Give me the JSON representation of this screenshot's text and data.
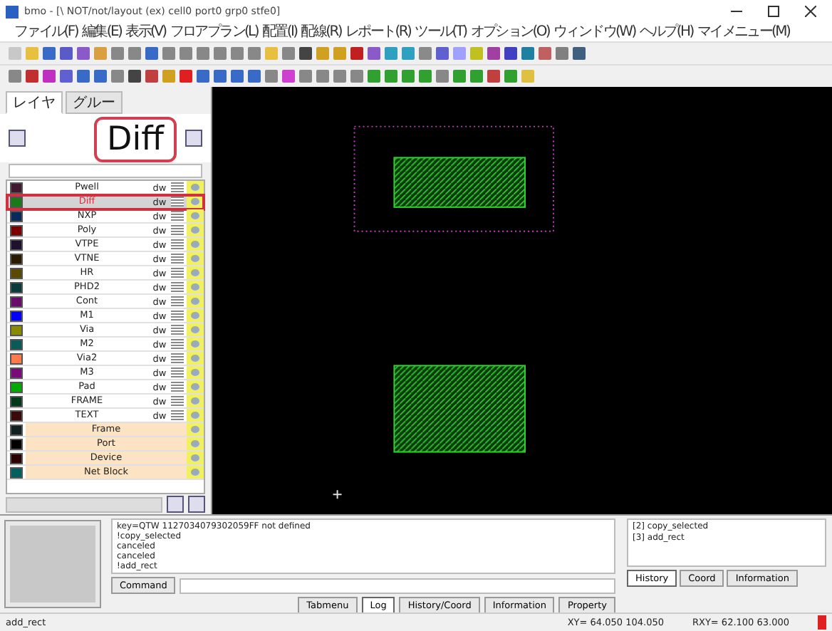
{
  "window": {
    "title": "bmo - [\\ NOT/not/layout (ex) cell0 port0 grp0 stfe0]"
  },
  "menu": [
    "ファイル(F)",
    "編集(E)",
    "表示(V)",
    "フロアプラン(L)",
    "配置(I)",
    "配線(R)",
    "レポート(R)",
    "ツール(T)",
    "オプション(O)",
    "ウィンドウ(W)",
    "ヘルプ(H)",
    "マイメニュー(M)"
  ],
  "layer_panel": {
    "tabs": [
      {
        "label": "レイヤ",
        "selected": true
      },
      {
        "label": "グルー",
        "selected": false
      }
    ],
    "callout": "Diff",
    "layers": [
      {
        "kind": "layer",
        "name": "Pwell",
        "mode": "dw",
        "color": "#401830",
        "selected": false
      },
      {
        "kind": "layer",
        "name": "Diff",
        "mode": "dw",
        "color": "#1a7a1a",
        "selected": true
      },
      {
        "kind": "layer",
        "name": "NXP",
        "mode": "dw",
        "color": "#0a2a5a",
        "selected": false
      },
      {
        "kind": "layer",
        "name": "Poly",
        "mode": "dw",
        "color": "#7a0000",
        "selected": false
      },
      {
        "kind": "layer",
        "name": "VTPE",
        "mode": "dw",
        "color": "#201030",
        "selected": false
      },
      {
        "kind": "layer",
        "name": "VTNE",
        "mode": "dw",
        "color": "#2a1a00",
        "selected": false
      },
      {
        "kind": "layer",
        "name": "HR",
        "mode": "dw",
        "color": "#5a4a00",
        "selected": false
      },
      {
        "kind": "layer",
        "name": "PHD2",
        "mode": "dw",
        "color": "#0a3a3a",
        "selected": false
      },
      {
        "kind": "layer",
        "name": "Cont",
        "mode": "dw",
        "color": "#6a0a6a",
        "selected": false
      },
      {
        "kind": "layer",
        "name": "M1",
        "mode": "dw",
        "color": "#0000ff",
        "selected": false
      },
      {
        "kind": "layer",
        "name": "Via",
        "mode": "dw",
        "color": "#8a8a00",
        "selected": false
      },
      {
        "kind": "layer",
        "name": "M2",
        "mode": "dw",
        "color": "#0a5a5a",
        "selected": false
      },
      {
        "kind": "layer",
        "name": "Via2",
        "mode": "dw",
        "color": "#ff7a4a",
        "selected": false
      },
      {
        "kind": "layer",
        "name": "M3",
        "mode": "dw",
        "color": "#7a0a7a",
        "selected": false
      },
      {
        "kind": "layer",
        "name": "Pad",
        "mode": "dw",
        "color": "#00aa00",
        "selected": false
      },
      {
        "kind": "layer",
        "name": "FRAME",
        "mode": "dw",
        "color": "#003a1a",
        "selected": false
      },
      {
        "kind": "layer",
        "name": "TEXT",
        "mode": "dw",
        "color": "#3a0a0a",
        "selected": false
      },
      {
        "kind": "group",
        "name": "Frame",
        "color": "#102020",
        "selected": false
      },
      {
        "kind": "group",
        "name": "Port",
        "color": "#000000",
        "selected": false
      },
      {
        "kind": "group",
        "name": "Device",
        "color": "#2a0000",
        "selected": false
      },
      {
        "kind": "group",
        "name": "Net Block",
        "color": "#006060",
        "selected": false
      }
    ]
  },
  "log": {
    "lines": [
      "key=QTW 1127034079302059FF not defined",
      "!copy_selected",
      "canceled",
      "canceled",
      "!add_rect"
    ]
  },
  "command_button": "Command",
  "history": {
    "items": [
      "[2] copy_selected",
      "[3] add_rect"
    ],
    "tabs": [
      {
        "label": "History",
        "selected": true
      },
      {
        "label": "Coord",
        "selected": false
      },
      {
        "label": "Information",
        "selected": false
      }
    ]
  },
  "panel_tabs": [
    {
      "label": "Tabmenu",
      "selected": false
    },
    {
      "label": "Log",
      "selected": true
    },
    {
      "label": "History/Coord",
      "selected": false
    },
    {
      "label": "Information",
      "selected": false
    },
    {
      "label": "Property",
      "selected": false
    }
  ],
  "status_bar": {
    "message": "add_rect",
    "xy": "XY= 64.050 104.050",
    "rxy": "RXY= 62.100 63.000"
  }
}
